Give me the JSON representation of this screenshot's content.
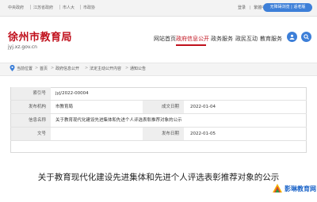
{
  "topbar": {
    "links": [
      "中央政府",
      "江苏省政府",
      "市人大",
      "市政协"
    ],
    "login": "登录",
    "lang": "繁體中文",
    "button": "无障碍浏览 | 适老版"
  },
  "header": {
    "title": "徐州市教育局",
    "domain": "jyj.xz.gov.cn",
    "nav": [
      "网站首页",
      "政府信息公开",
      "政务服务",
      "政民互动",
      "教育服务"
    ]
  },
  "breadcrumb": {
    "label": "当前位置",
    "items": [
      "首页",
      "政府信息公开",
      "法定主动公开内容",
      "通知公告"
    ],
    "separator": ">"
  },
  "info_table": {
    "index_label": "索引号",
    "index_value": "jyj/2022-00004",
    "publisher_label": "发布机构",
    "publisher_value": "市教育局",
    "date_made_label": "成文日期",
    "date_made_value": "2022-01-04",
    "name_label": "信息名称",
    "name_value": "关于教育现代化建设先进集体和先进个人评选表彰推荐对象的公示",
    "doc_no_label": "文号",
    "doc_no_value": "",
    "publish_date_label": "发布日期",
    "publish_date_value": "2022-01-05"
  },
  "article": {
    "title": "关于教育现代化建设先进集体和先进个人评选表彰推荐对象的公示"
  },
  "watermark": {
    "text": "影琳教育网"
  },
  "colors": {
    "brand_red": "#c0101c",
    "accent_blue": "#3d7fd8"
  }
}
